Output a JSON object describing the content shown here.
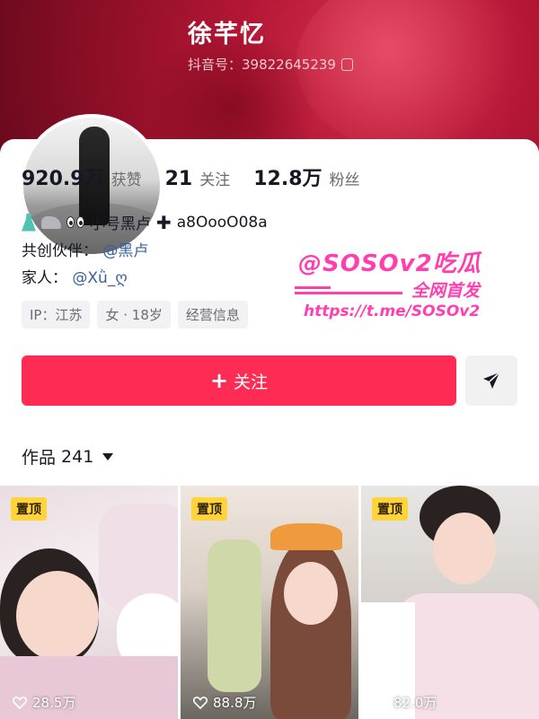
{
  "profile": {
    "nickname": "徐芊忆",
    "douyin_id": "抖音号：39822645239"
  },
  "stats": {
    "likes_num": "920.9万",
    "likes_label": "获赞",
    "following_num": "21",
    "following_label": "关注",
    "fans_num": "12.8万",
    "fans_label": "粉丝"
  },
  "bio": {
    "line1_text": "小号黑卢",
    "line1_suffix": "a8OooO08a",
    "cocreator_label": "共创伙伴：",
    "cocreator_mention": "@黑卢",
    "family_label": "家人：",
    "family_mention": "@Xǜ_ღ"
  },
  "tags": [
    "IP：江苏",
    "女 · 18岁",
    "经营信息"
  ],
  "watermark": {
    "title": "@SOSOv2吃瓜",
    "subtitle": "全网首发",
    "url": "https://t.me/SOSOv2"
  },
  "actions": {
    "follow_label": "关注"
  },
  "works": {
    "label": "作品",
    "count": "241"
  },
  "videos": [
    {
      "badge": "置顶",
      "likes": "28.5万"
    },
    {
      "badge": "置顶",
      "likes": "88.8万"
    },
    {
      "badge": "置顶",
      "likes": "82.0万"
    }
  ],
  "colors": {
    "accent": "#fe2c55",
    "cover": "#b51736",
    "mention": "#3a5fa0",
    "pin_badge": "#ffd43b",
    "watermark": "#ff3fb0"
  },
  "icons": [
    "copy-icon",
    "dress-emoji",
    "shoe-emoji",
    "eyes-emoji",
    "plus-icon",
    "send-icon",
    "caret-down-icon",
    "heart-icon"
  ]
}
